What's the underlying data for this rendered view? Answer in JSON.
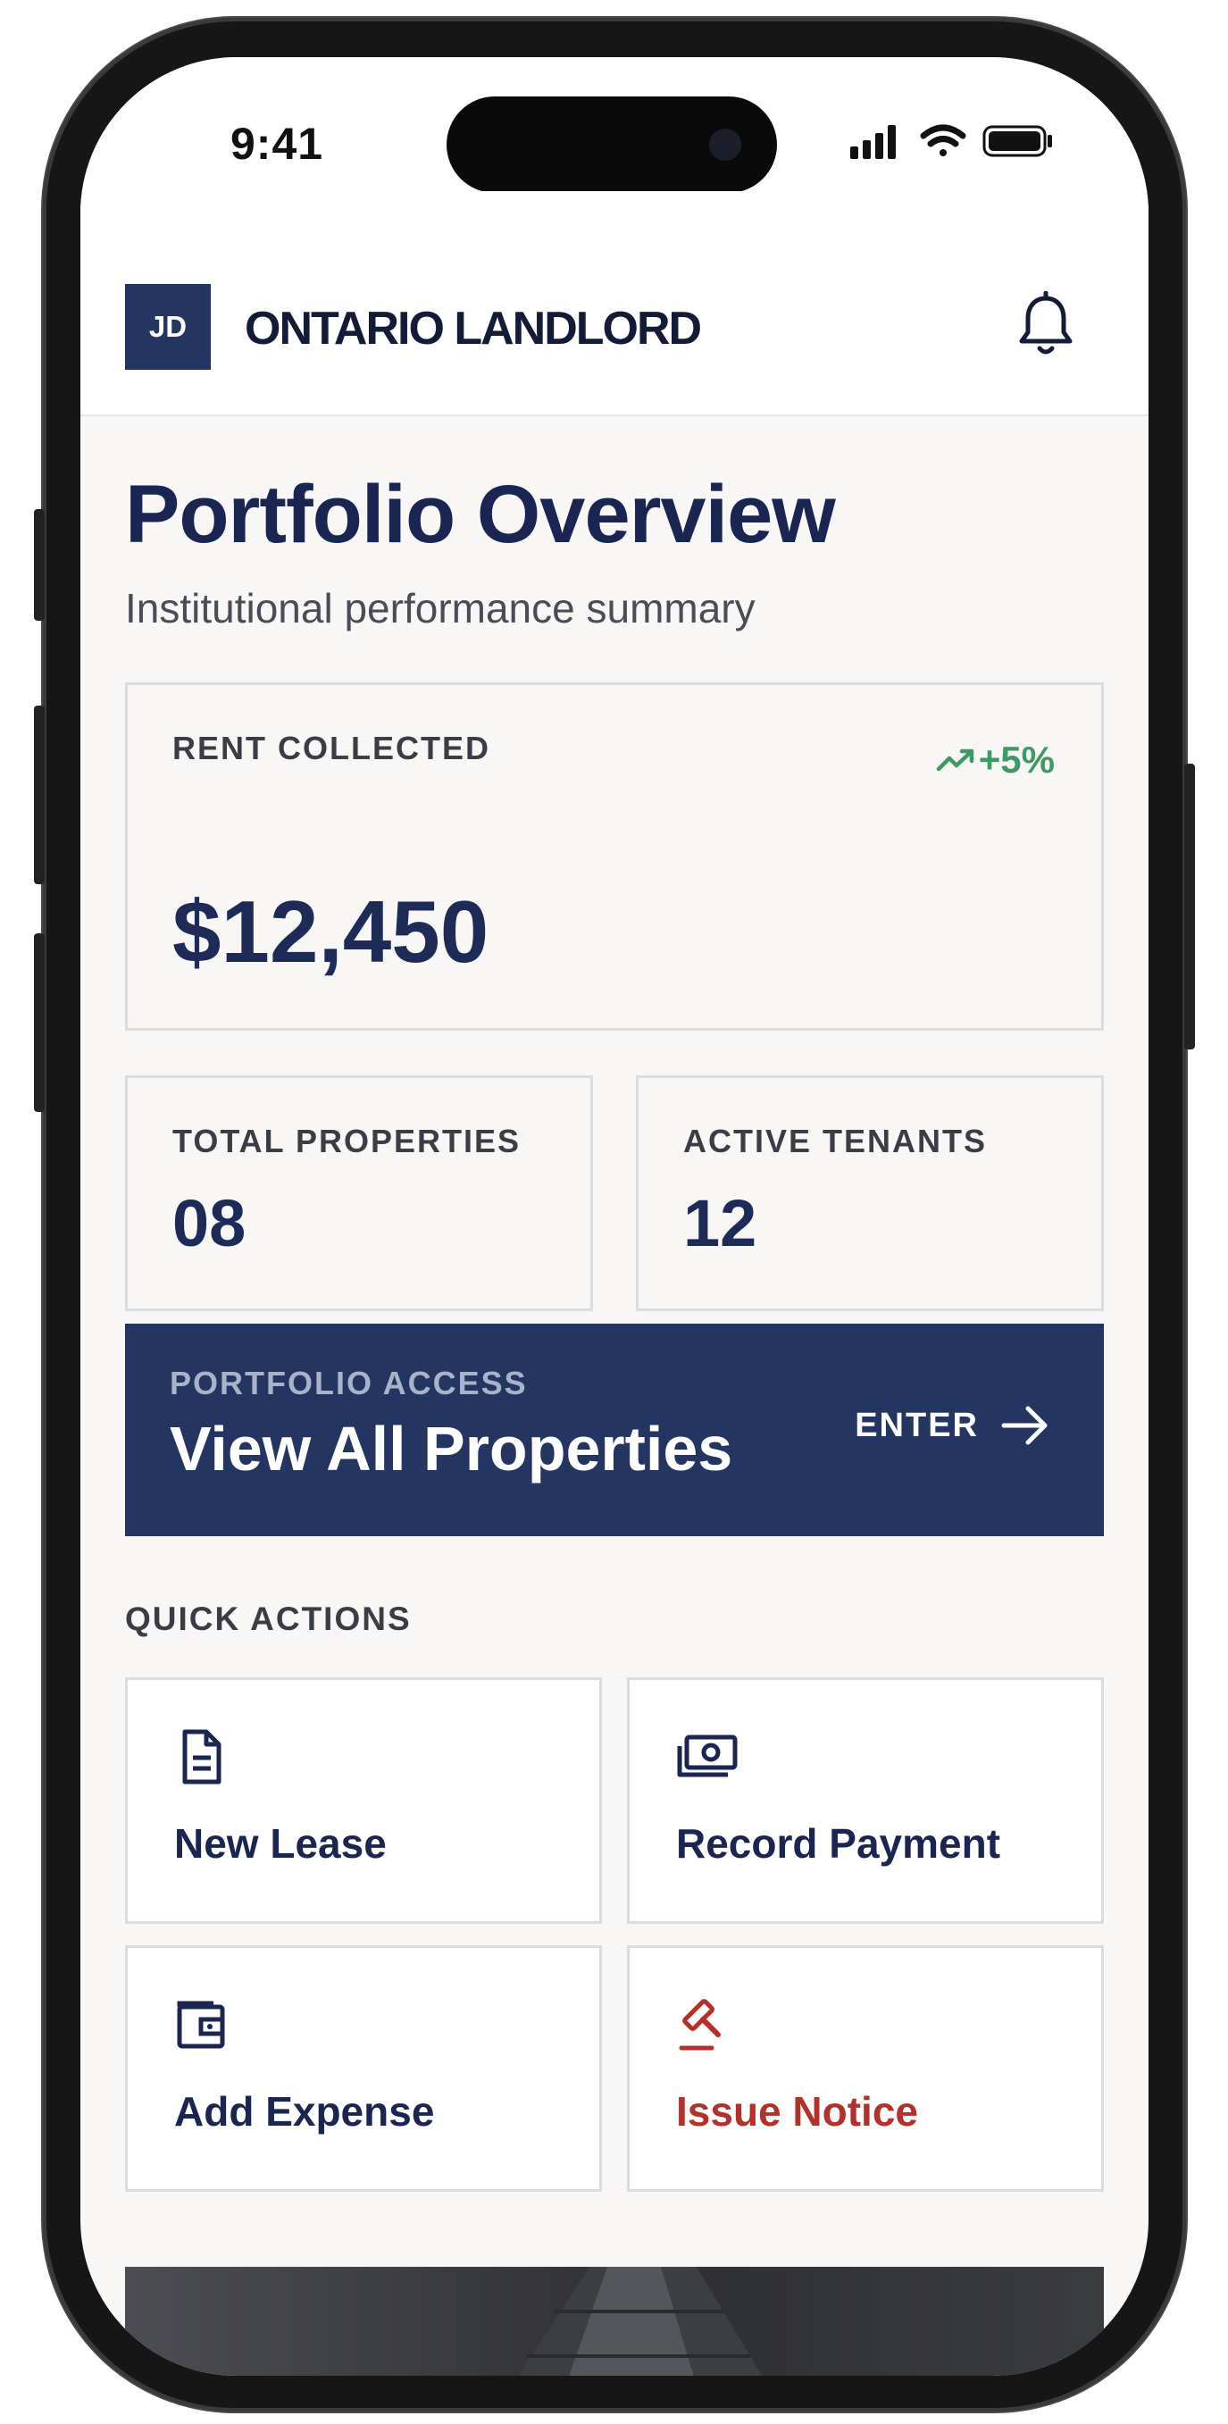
{
  "status_bar": {
    "time": "9:41"
  },
  "header": {
    "avatar_initials": "JD",
    "brand": "ONTARIO LANDLORD",
    "notification_icon": "bell-icon"
  },
  "page": {
    "title": "Portfolio Overview",
    "subtitle": "Institutional performance summary"
  },
  "metrics": {
    "rent_collected": {
      "label": "RENT COLLECTED",
      "value": "$12,450",
      "trend": "+5%",
      "trend_icon": "trending-up-icon"
    },
    "total_properties": {
      "label": "TOTAL PROPERTIES",
      "value": "08"
    },
    "active_tenants": {
      "label": "ACTIVE TENANTS",
      "value": "12"
    }
  },
  "portfolio_access": {
    "kicker": "PORTFOLIO ACCESS",
    "title": "View All Properties",
    "action": "ENTER",
    "icon": "arrow-right-icon"
  },
  "quick_actions": {
    "label": "QUICK ACTIONS",
    "items": [
      {
        "label": "New Lease",
        "icon": "document-icon"
      },
      {
        "label": "Record Payment",
        "icon": "cash-icon"
      },
      {
        "label": "Add Expense",
        "icon": "wallet-icon"
      },
      {
        "label": "Issue Notice",
        "icon": "gavel-icon"
      }
    ]
  },
  "colors": {
    "brand_navy": "#253561",
    "title_navy": "#1b2551",
    "positive_green": "#3d9a64",
    "danger_red": "#b3302b"
  }
}
